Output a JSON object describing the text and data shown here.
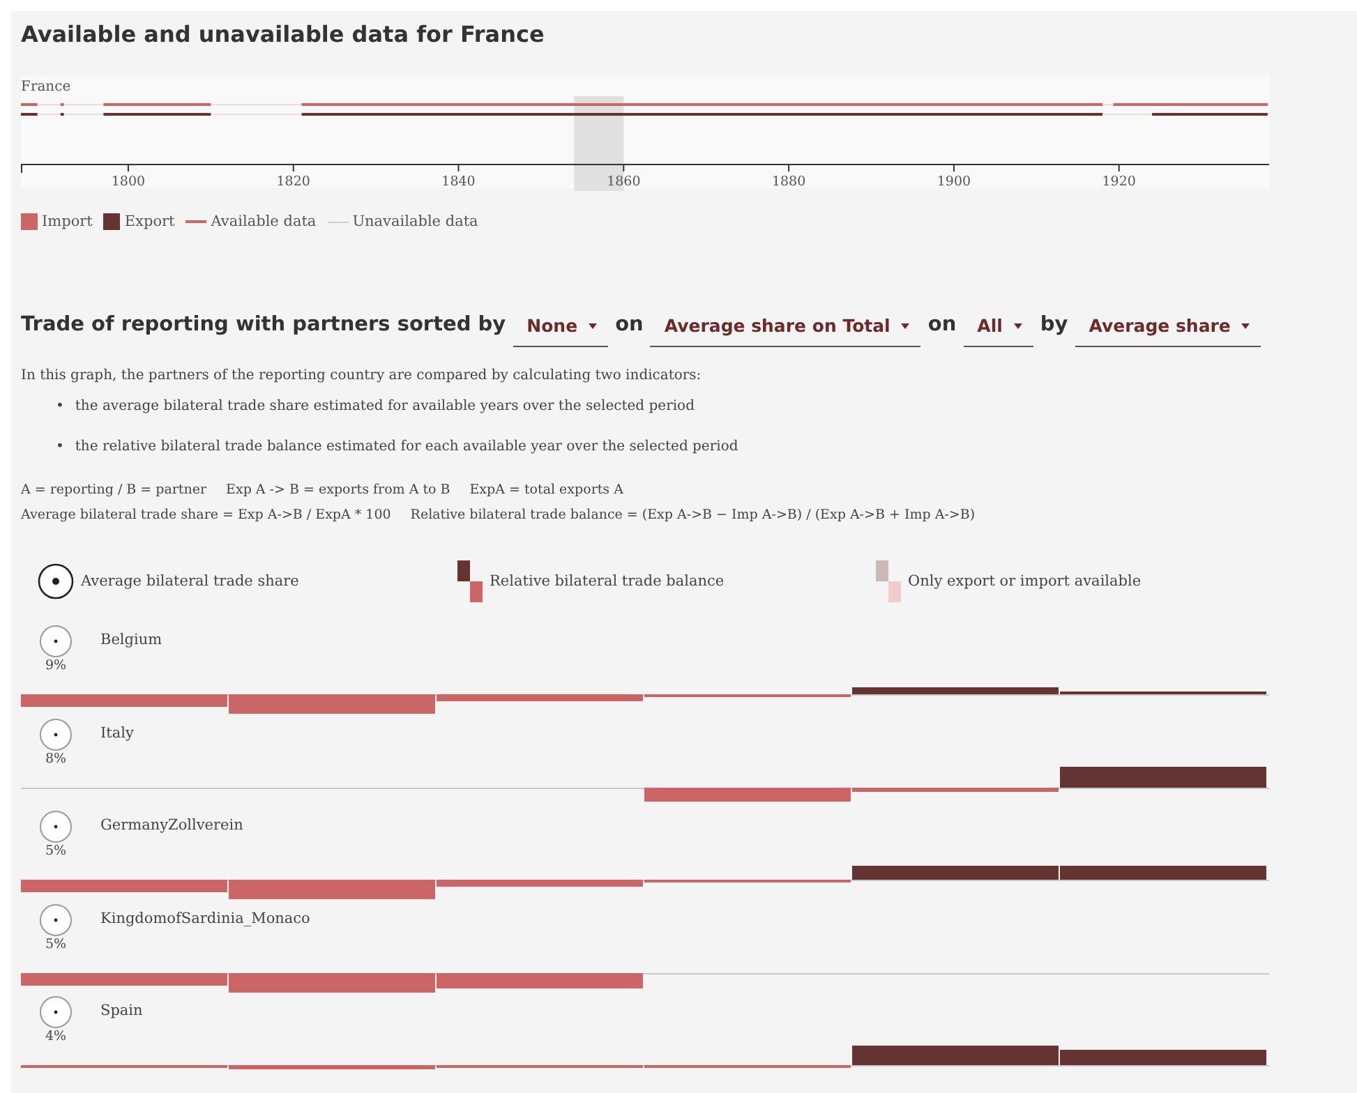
{
  "availability": {
    "title": "Available and unavailable data for France",
    "country": "France",
    "ticks": [
      "1800",
      "1820",
      "1840",
      "1860",
      "1880",
      "1900",
      "1920"
    ],
    "legend": [
      {
        "kind": "swatch",
        "label": "Import",
        "color": "#cc6666"
      },
      {
        "kind": "swatch",
        "label": "Export",
        "color": "#663333"
      },
      {
        "kind": "line",
        "label": "Available data",
        "color": "#cc6666"
      },
      {
        "kind": "thin",
        "label": "Unavailable data",
        "color": "#e0c8c8"
      }
    ]
  },
  "trade": {
    "heading": [
      {
        "kind": "text",
        "text": "Trade of reporting with partners sorted by"
      },
      {
        "kind": "dropdown",
        "text": "None"
      },
      {
        "kind": "text",
        "text": "on"
      },
      {
        "kind": "dropdown",
        "text": "Average share on Total"
      },
      {
        "kind": "text",
        "text": "on"
      },
      {
        "kind": "dropdown",
        "text": "All"
      },
      {
        "kind": "text",
        "text": "by"
      },
      {
        "kind": "dropdown",
        "text": "Average share"
      }
    ],
    "intro": "In this graph, the partners of the reporting country are compared by calculating two indicators:",
    "bullets": [
      {
        "marker": "•",
        "text": "the average bilateral trade share estimated for available years over the selected period"
      },
      {
        "marker": "•",
        "text": "the relative bilateral trade balance estimated for each available year over the selected period"
      }
    ],
    "definitions": [
      [
        "A = reporting / B = partner",
        "Exp A -> B = exports from A to B",
        "ExpA = total exports A"
      ],
      [
        "Average bilateral trade share = Exp A->B / ExpA * 100",
        "Relative bilateral trade balance = (Exp A->B − Imp A->B) / (Exp A->B + Imp A->B)"
      ]
    ],
    "legend": [
      {
        "kind": "circle",
        "label": "Average bilateral trade share"
      },
      {
        "kind": "balance",
        "label": "Relative bilateral trade balance"
      },
      {
        "kind": "partial",
        "label": "Only export or import available"
      }
    ],
    "partners": [
      {
        "name": "Belgium",
        "share": "9%"
      },
      {
        "name": "Italy",
        "share": "8%"
      },
      {
        "name": "GermanyZollverein",
        "share": "5%"
      },
      {
        "name": "KingdomofSardinia_Monaco",
        "share": "5%"
      },
      {
        "name": "Spain",
        "share": "4%"
      }
    ]
  }
}
